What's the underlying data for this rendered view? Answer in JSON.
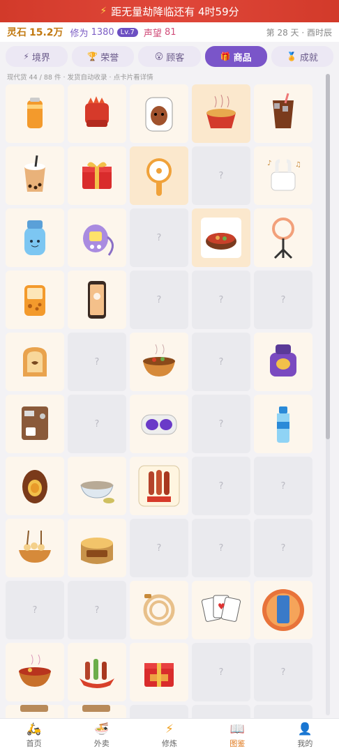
{
  "banner": {
    "icon": "lightning-icon",
    "text": "距无量劫降临还有 4时59分"
  },
  "status": {
    "stone_label": "灵石",
    "stone_value": "15.2万",
    "cultivation_label": "修为",
    "cultivation_value": "1380",
    "level": "Lv.7",
    "fame_label": "声望",
    "fame_value": "81",
    "day": "第 28 天 · 酉时辰"
  },
  "tabs": [
    {
      "label": "境界",
      "icon": "lightning-icon"
    },
    {
      "label": "荣誉",
      "icon": "trophy-icon"
    },
    {
      "label": "顾客",
      "icon": "face-icon"
    },
    {
      "label": "商品",
      "icon": "gift-icon",
      "active": true
    },
    {
      "label": "成就",
      "icon": "medal-icon"
    }
  ],
  "hint": "现代货 44 / 88 件 · 发货自动收录 · 点卡片看详情",
  "locked_mark": "?",
  "grid": [
    {
      "owned": true,
      "item": "orange-drink-can"
    },
    {
      "owned": true,
      "item": "spicy-sticks"
    },
    {
      "owned": true,
      "item": "marinated-egg-pack"
    },
    {
      "owned": true,
      "highlight": true,
      "item": "instant-noodle-bowl"
    },
    {
      "owned": true,
      "item": "iced-cola-cup"
    },
    {
      "owned": true,
      "item": "bubble-tea"
    },
    {
      "owned": true,
      "item": "red-gift-box"
    },
    {
      "owned": true,
      "highlight": true,
      "item": "handheld-fan"
    },
    {
      "owned": false
    },
    {
      "owned": true,
      "item": "wireless-earbuds"
    },
    {
      "owned": true,
      "item": "water-bottle"
    },
    {
      "owned": true,
      "item": "tamagotchi"
    },
    {
      "owned": false
    },
    {
      "owned": true,
      "highlight": true,
      "item": "hot-pot"
    },
    {
      "owned": true,
      "item": "ring-light"
    },
    {
      "owned": true,
      "item": "game-console"
    },
    {
      "owned": true,
      "item": "smartphone"
    },
    {
      "owned": false
    },
    {
      "owned": false
    },
    {
      "owned": false
    },
    {
      "owned": true,
      "item": "toast-bread"
    },
    {
      "owned": false
    },
    {
      "owned": true,
      "item": "noodle-bowl"
    },
    {
      "owned": false
    },
    {
      "owned": true,
      "item": "purple-machine"
    },
    {
      "owned": true,
      "item": "coffee-machine"
    },
    {
      "owned": false
    },
    {
      "owned": true,
      "item": "vr-headset"
    },
    {
      "owned": false
    },
    {
      "owned": true,
      "item": "mineral-water"
    },
    {
      "owned": true,
      "item": "chocolate-egg"
    },
    {
      "owned": true,
      "item": "porridge-bowl"
    },
    {
      "owned": true,
      "item": "bbq-skewers"
    },
    {
      "owned": false
    },
    {
      "owned": false
    },
    {
      "owned": true,
      "item": "fish-balls"
    },
    {
      "owned": true,
      "item": "jianbing-basket"
    },
    {
      "owned": false
    },
    {
      "owned": false
    },
    {
      "owned": false
    },
    {
      "owned": false
    },
    {
      "owned": false
    },
    {
      "owned": true,
      "item": "charging-cable"
    },
    {
      "owned": true,
      "item": "playing-cards"
    },
    {
      "owned": true,
      "item": "phone-case"
    },
    {
      "owned": true,
      "item": "spicy-hotpot-bowl"
    },
    {
      "owned": true,
      "item": "skewer-platter"
    },
    {
      "owned": true,
      "item": "red-gift-box-2"
    },
    {
      "owned": false
    },
    {
      "owned": false
    },
    {
      "owned": true,
      "item": "partial"
    },
    {
      "owned": true,
      "item": "partial"
    },
    {
      "owned": false
    },
    {
      "owned": false
    },
    {
      "owned": false
    }
  ],
  "nav": [
    {
      "label": "首页",
      "icon": "scooter-icon"
    },
    {
      "label": "外卖",
      "icon": "bowl-icon"
    },
    {
      "label": "修炼",
      "icon": "lightning-icon"
    },
    {
      "label": "图鉴",
      "icon": "book-icon",
      "active": true
    },
    {
      "label": "我的",
      "icon": "user-icon"
    }
  ]
}
